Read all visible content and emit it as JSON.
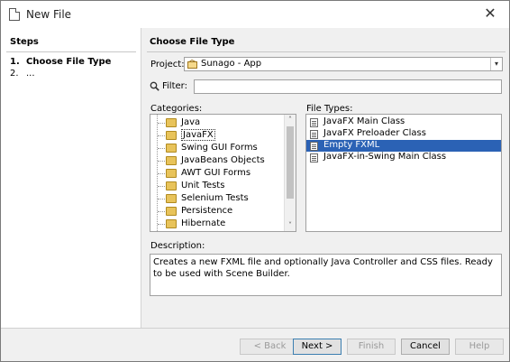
{
  "window": {
    "title": "New File",
    "close": "✕"
  },
  "steps": {
    "title": "Steps",
    "items": [
      {
        "num": "1.",
        "label": "Choose File Type"
      },
      {
        "num": "2.",
        "label": "..."
      }
    ]
  },
  "main": {
    "title": "Choose File Type",
    "project_label": "Project:",
    "project_value": "Sunago - App",
    "filter_label": "Filter:",
    "filter_value": "",
    "categories_label": "Categories:",
    "file_types_label": "File Types:",
    "categories": [
      "Java",
      "JavaFX",
      "Swing GUI Forms",
      "JavaBeans Objects",
      "AWT GUI Forms",
      "Unit Tests",
      "Selenium Tests",
      "Persistence",
      "Hibernate"
    ],
    "selected_category": "JavaFX",
    "file_types": [
      "JavaFX Main Class",
      "JavaFX Preloader Class",
      "Empty FXML",
      "JavaFX-in-Swing Main Class"
    ],
    "selected_file_type": "Empty FXML",
    "description_label": "Description:",
    "description": "Creates a new FXML file and optionally Java Controller and CSS files. Ready to be used with Scene Builder."
  },
  "buttons": {
    "back": "< Back",
    "next": "Next >",
    "finish": "Finish",
    "cancel": "Cancel",
    "help": "Help"
  },
  "colors": {
    "selection": "#2b62b5",
    "folder": "#e8c35a"
  }
}
